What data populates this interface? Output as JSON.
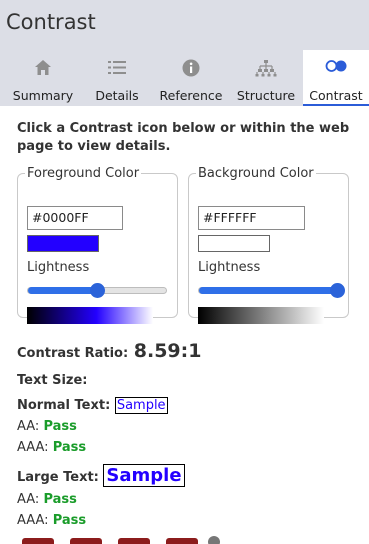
{
  "header": {
    "title": "Contrast"
  },
  "tabs": [
    {
      "label": "Summary",
      "icon": "home-icon"
    },
    {
      "label": "Details",
      "icon": "list-icon"
    },
    {
      "label": "Reference",
      "icon": "info-icon"
    },
    {
      "label": "Structure",
      "icon": "hierarchy-icon"
    },
    {
      "label": "Contrast",
      "icon": "contrast-icon",
      "active": true
    }
  ],
  "intro": "Click a Contrast icon below or within the web page to view details.",
  "foreground": {
    "legend": "Foreground Color",
    "hex": "#0000FF",
    "swatch_color": "#2300ff",
    "lightness_label": "Lightness",
    "lightness": 0.5
  },
  "background": {
    "legend": "Background Color",
    "hex": "#FFFFFF",
    "swatch_color": "#ffffff",
    "lightness_label": "Lightness",
    "lightness": 1.0
  },
  "ratio": {
    "label": "Contrast Ratio:",
    "value": "8.59:1"
  },
  "text_size": {
    "label": "Text Size:"
  },
  "normal": {
    "label": "Normal Text:",
    "sample": "Sample",
    "aa_label": "AA:",
    "aa": "Pass",
    "aaa_label": "AAA:",
    "aaa": "Pass"
  },
  "large": {
    "label": "Large Text:",
    "sample": "Sample",
    "aa_label": "AA:",
    "aa": "Pass",
    "aaa_label": "AAA:",
    "aaa": "Pass"
  },
  "colors": {
    "header_bg": "#dcdee6",
    "accent": "#2b5cd8",
    "pass": "#1a9c2a",
    "contrast_icon": "#8c1c1c"
  }
}
